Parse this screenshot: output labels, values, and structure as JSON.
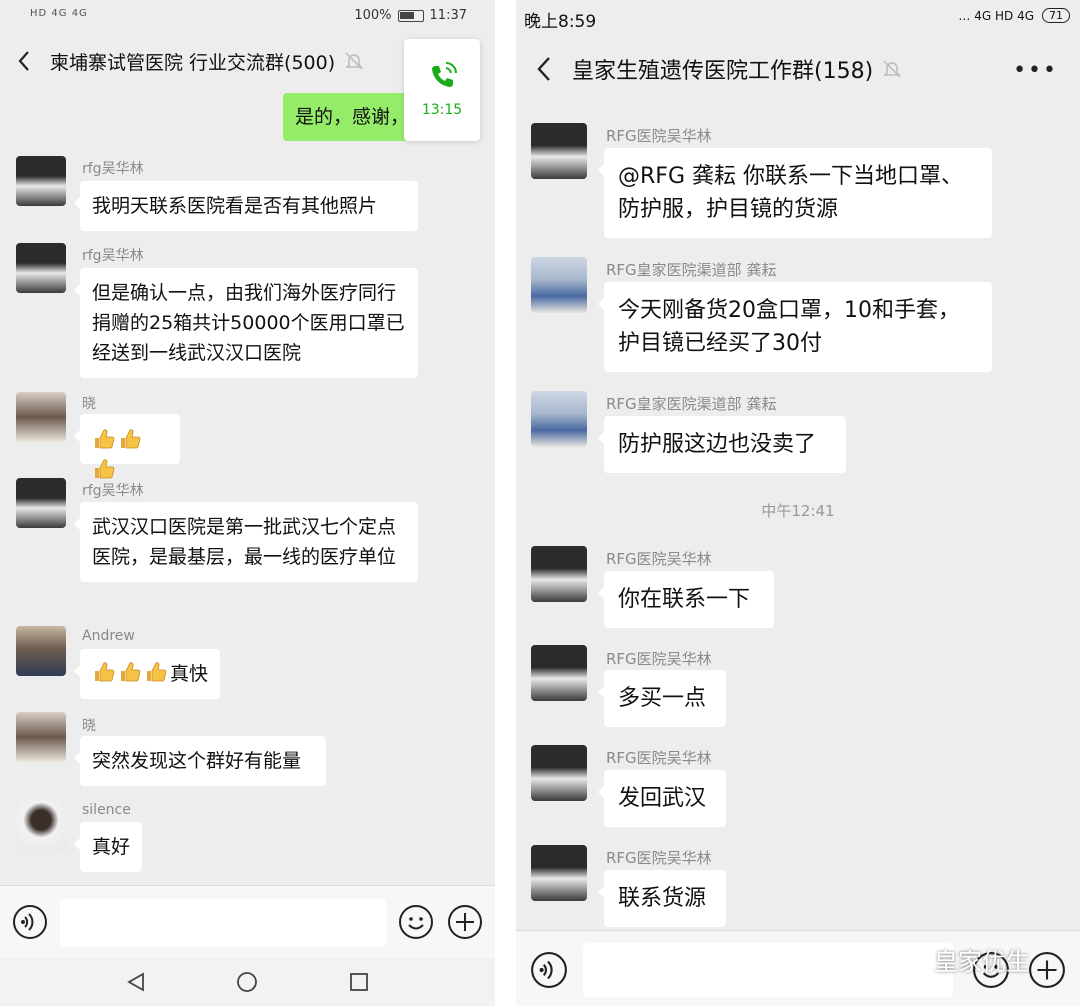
{
  "left": {
    "status": {
      "left_icons": "HD 4G 4G",
      "battery": "100%",
      "time": "11:37"
    },
    "header": {
      "title": "柬埔寨试管医院 行业交流群(500)"
    },
    "call": {
      "time": "13:15"
    },
    "self_message": "是的，感谢，",
    "messages": [
      {
        "sender": "rfg吴华林",
        "text": "我明天联系医院看是否有其他照片"
      },
      {
        "sender": "rfg吴华林",
        "text": "但是确认一点，由我们海外医疗同行捐赠的25箱共计50000个医用口罩已经送到一线武汉汉口医院"
      },
      {
        "sender": "晓",
        "text": ""
      },
      {
        "sender": "rfg吴华林",
        "text": "武汉汉口医院是第一批武汉七个定点医院，是最基层，最一线的医疗单位"
      },
      {
        "sender": "Andrew",
        "text": "真快"
      },
      {
        "sender": "晓",
        "text": "突然发现这个群好有能量"
      },
      {
        "sender": "silence",
        "text": "真好"
      }
    ]
  },
  "right": {
    "status": {
      "time": "晚上8:59",
      "battery": "71",
      "icons": "… 4G HD 4G"
    },
    "header": {
      "title": "皇家生殖遗传医院工作群(158)"
    },
    "messages": [
      {
        "sender": "RFG医院吴华林",
        "text": "@RFG 龚耘  你联系一下当地口罩、防护服，护目镜的货源"
      },
      {
        "sender": "RFG皇家医院渠道部 龚耘",
        "text": "今天刚备货20盒口罩，10和手套，护目镜已经买了30付"
      },
      {
        "sender": "RFG皇家医院渠道部 龚耘",
        "text": "防护服这边也没卖了"
      },
      {
        "sender": "RFG医院吴华林",
        "text": "你在联系一下"
      },
      {
        "sender": "RFG医院吴华林",
        "text": "多买一点"
      },
      {
        "sender": "RFG医院吴华林",
        "text": "发回武汉"
      },
      {
        "sender": "RFG医院吴华林",
        "text": "联系货源"
      }
    ],
    "time_divider": "中午12:41"
  },
  "watermark": "皇家优生",
  "colors": {
    "chat_bg": "#ededed",
    "self_bubble": "#95ec69",
    "call_green": "#1aad19"
  },
  "icons": [
    "back-icon",
    "mute-icon",
    "phone-icon",
    "voice-icon",
    "emoji-icon",
    "plus-icon",
    "more-icon",
    "thumbs-up-icon",
    "nav-back-icon",
    "nav-home-icon",
    "nav-recent-icon",
    "wechat-logo-icon"
  ]
}
